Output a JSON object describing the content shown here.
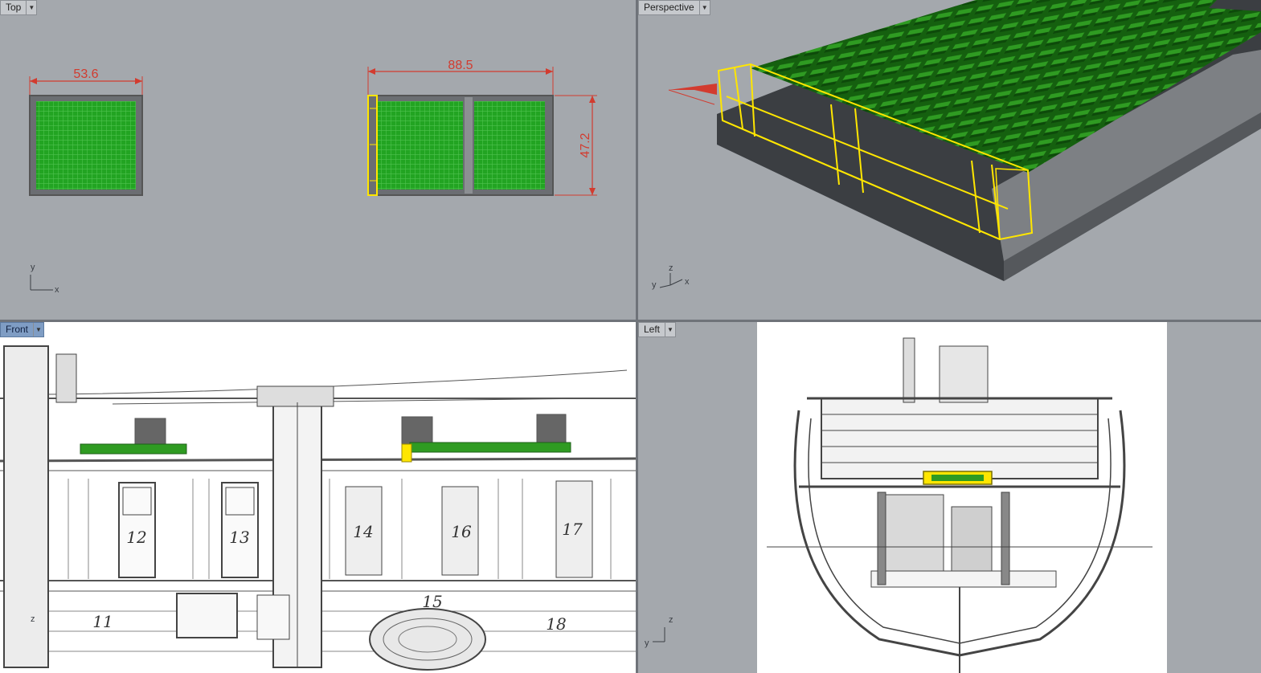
{
  "viewports": {
    "top": {
      "label": "Top",
      "dims": {
        "width_left": "53.6",
        "width_right": "88.5",
        "height_right": "47.2"
      },
      "axes": {
        "a": "y",
        "b": "x"
      }
    },
    "perspective": {
      "label": "Perspective",
      "axes": {
        "a": "z",
        "b": "y",
        "c": "x"
      }
    },
    "front": {
      "label": "Front",
      "cabin_numbers": [
        "12",
        "13",
        "14",
        "16",
        "17",
        "11",
        "15",
        "18"
      ],
      "axis": "z"
    },
    "left": {
      "label": "Left",
      "axes": {
        "a": "z",
        "b": "y"
      }
    }
  },
  "colors": {
    "viewport_bg": "#a4a8ad",
    "selection": "#ffe600",
    "grating": "#1f8f1f",
    "dimension": "#d23b2f",
    "active_label": "#7f9dc4"
  },
  "icons": {
    "dropdown": "chevron-down-icon"
  }
}
